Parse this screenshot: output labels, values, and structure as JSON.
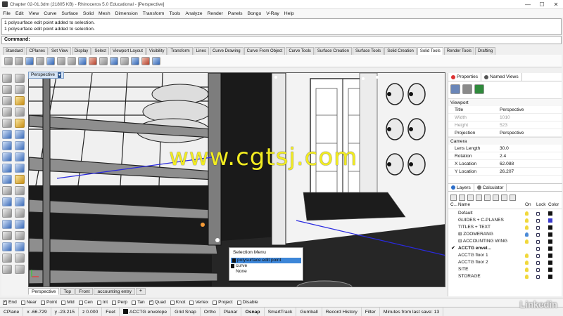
{
  "window": {
    "title": "Chapter 02-01.3dm (21805 KB) - Rhinoceros 5.0 Educational - [Perspective]",
    "controls": [
      "—",
      "☐",
      "✕"
    ]
  },
  "menu": [
    "File",
    "Edit",
    "View",
    "Curve",
    "Surface",
    "Solid",
    "Mesh",
    "Dimension",
    "Transform",
    "Tools",
    "Analyze",
    "Render",
    "Panels",
    "Bongo",
    "V-Ray",
    "Help"
  ],
  "command_history": [
    "1 polysurface edit point added to selection.",
    "1 polysurface edit point added to selection."
  ],
  "command_prompt": "Command:",
  "toolbar_tabs": [
    "Standard",
    "CPlanes",
    "Set View",
    "Display",
    "Select",
    "Viewport Layout",
    "Visibility",
    "Transform",
    "Lines",
    "Curve Drawing",
    "Curve From Object",
    "Curve Tools",
    "Surface Creation",
    "Surface Tools",
    "Solid Creation",
    "Solid Tools",
    "Render Tools",
    "Drafting"
  ],
  "active_toolbar_tab": "Solid Tools",
  "viewport": {
    "label": "Perspective",
    "tabs": [
      "Perspective",
      "Top",
      "Front",
      "accounting entry"
    ],
    "add_tab": "+"
  },
  "watermark": "www.cgtsj.com",
  "selection_menu": {
    "title": "Selection Menu",
    "items": [
      "polysurface edit point",
      "curve",
      "None"
    ],
    "highlighted": "polysurface edit point"
  },
  "panel_tabs": [
    "Properties",
    "Named Views"
  ],
  "properties": {
    "viewport_header": "Viewport",
    "rows": [
      {
        "k": "Title",
        "v": "Perspective",
        "dim": false
      },
      {
        "k": "Width",
        "v": "1010",
        "dim": true
      },
      {
        "k": "Height",
        "v": "523",
        "dim": true
      },
      {
        "k": "Projection",
        "v": "Perspective",
        "dim": false
      }
    ],
    "camera_header": "Camera",
    "camera_rows": [
      {
        "k": "Lens Length",
        "v": "30.0"
      },
      {
        "k": "Rotation",
        "v": "2.4"
      },
      {
        "k": "X Location",
        "v": "62.088"
      },
      {
        "k": "Y Location",
        "v": "26.207"
      }
    ]
  },
  "layer_tabs": [
    "Layers",
    "Calculator"
  ],
  "layer_headers": {
    "c": "C...",
    "name": "Name",
    "on": "On",
    "lock": "Lock",
    "color": "Color"
  },
  "layers": [
    {
      "name": "Default",
      "expand": "",
      "check": "",
      "on": "yellow",
      "color": "#111111"
    },
    {
      "name": "GUIDES + C-PLANES",
      "expand": "",
      "check": "",
      "on": "yellow",
      "color": "#3a3acc"
    },
    {
      "name": "TITLES + TEXT",
      "expand": "",
      "check": "",
      "on": "yellow",
      "color": "#111111"
    },
    {
      "name": "ZOOMERANG",
      "expand": "⊞",
      "check": "",
      "on": "blue",
      "color": "#111111"
    },
    {
      "name": "ACCOUNTING WING",
      "expand": "⊟",
      "check": "",
      "on": "yellow",
      "color": "#111111"
    },
    {
      "name": "ACCTG envel...",
      "expand": "",
      "check": "✔",
      "on": "",
      "color": "#111111",
      "bold": true
    },
    {
      "name": "ACCTG floor 1",
      "expand": "",
      "check": "",
      "on": "yellow",
      "color": "#111111"
    },
    {
      "name": "ACCTG floor 2",
      "expand": "",
      "check": "",
      "on": "yellow",
      "color": "#111111"
    },
    {
      "name": "SITE",
      "expand": "",
      "check": "",
      "on": "yellow",
      "color": "#111111"
    },
    {
      "name": "STORAGE",
      "expand": "",
      "check": "",
      "on": "yellow",
      "color": "#111111"
    }
  ],
  "osnaps": [
    {
      "label": "End",
      "on": true
    },
    {
      "label": "Near",
      "on": false
    },
    {
      "label": "Point",
      "on": false
    },
    {
      "label": "Mid",
      "on": false
    },
    {
      "label": "Cen",
      "on": false
    },
    {
      "label": "Int",
      "on": false
    },
    {
      "label": "Perp",
      "on": false
    },
    {
      "label": "Tan",
      "on": false
    },
    {
      "label": "Quad",
      "on": true
    },
    {
      "label": "Knot",
      "on": false
    },
    {
      "label": "Vertex",
      "on": false
    },
    {
      "label": "Project",
      "on": false
    },
    {
      "label": "Disable",
      "on": false
    }
  ],
  "status": {
    "cplane": "CPlane",
    "x": "x -66.729",
    "y": "y -23.215",
    "z": "z 0.000",
    "units": "Feet",
    "layer": "ACCTG envelope",
    "buttons": [
      "Grid Snap",
      "Ortho",
      "Planar",
      "Osnap",
      "SmartTrack",
      "Gumball",
      "Record History",
      "Filter"
    ],
    "bold_button": "Osnap",
    "save_info": "Minutes from last save: 13"
  },
  "brand": "Linkedin"
}
